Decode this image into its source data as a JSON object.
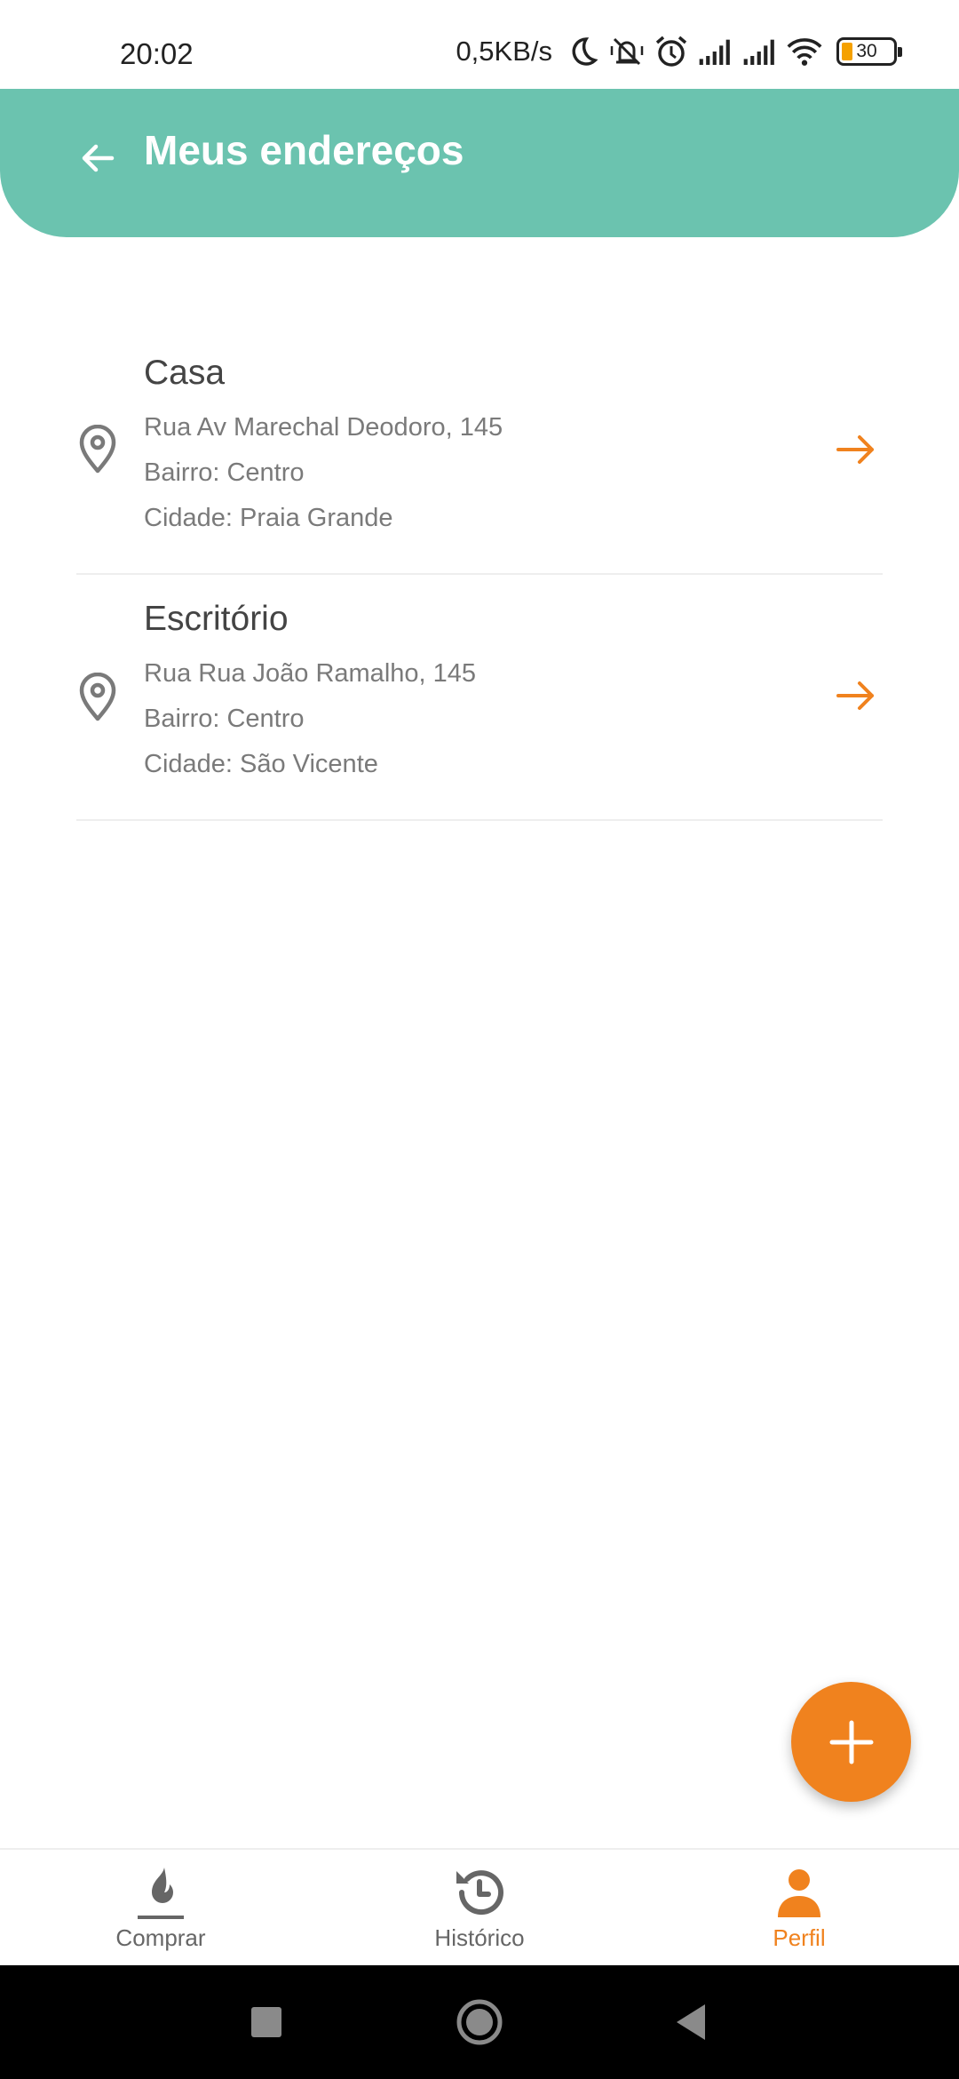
{
  "status_bar": {
    "time": "20:02",
    "network_speed": "0,5KB/s",
    "battery_level": "30",
    "icons": [
      "moon-icon",
      "vibrate-off-icon",
      "alarm-icon",
      "signal-icon",
      "signal-icon",
      "wifi-icon",
      "battery-icon"
    ]
  },
  "header": {
    "title": "Meus endereços",
    "back_icon": "arrow-left-icon",
    "background_color": "#6bc3af"
  },
  "addresses": [
    {
      "name": "Casa",
      "street": "Rua Av Marechal Deodoro, 145",
      "neighborhood": "Bairro: Centro",
      "city": "Cidade: Praia Grande"
    },
    {
      "name": "Escritório",
      "street": "Rua Rua João Ramalho, 145",
      "neighborhood": "Bairro: Centro",
      "city": "Cidade: São Vicente"
    }
  ],
  "fab": {
    "icon": "plus-icon",
    "color": "#f0821e"
  },
  "bottom_nav": {
    "items": [
      {
        "label": "Comprar",
        "icon": "flame-icon",
        "active": false
      },
      {
        "label": "Histórico",
        "icon": "history-icon",
        "active": false
      },
      {
        "label": "Perfil",
        "icon": "person-icon",
        "active": true
      }
    ],
    "active_color": "#f0821e"
  },
  "system_nav": {
    "icons": [
      "recents-icon",
      "home-icon",
      "back-icon"
    ]
  }
}
